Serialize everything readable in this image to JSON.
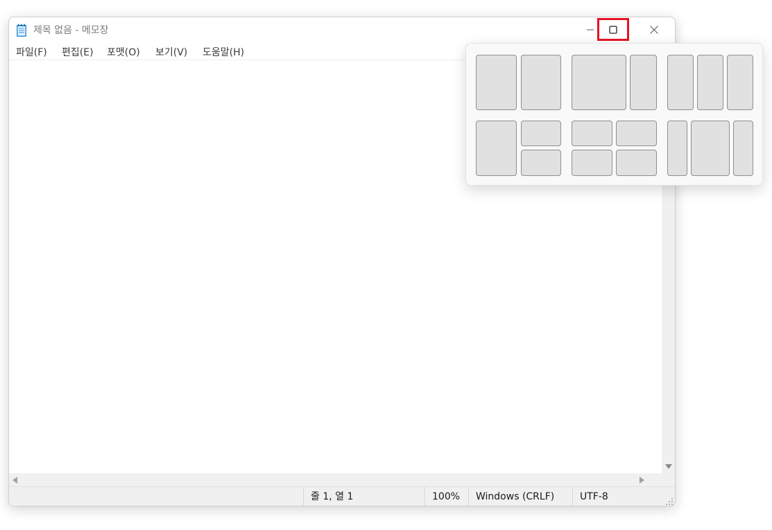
{
  "window": {
    "title": "제목 없음 - 메모장",
    "app_icon": "notepad-icon"
  },
  "title_controls": {
    "minimize_icon": "minimize-icon",
    "maximize_icon": "maximize-icon",
    "close_icon": "close-icon",
    "highlight_color": "#e81123"
  },
  "menubar": {
    "items": [
      {
        "label": "파일(F)"
      },
      {
        "label": "편집(E)"
      },
      {
        "label": "포맷(O)"
      },
      {
        "label": "보기(V)"
      },
      {
        "label": "도움말(H)"
      }
    ]
  },
  "editor": {
    "content": ""
  },
  "statusbar": {
    "position": "줄 1, 열 1",
    "zoom": "100%",
    "line_ending": "Windows (CRLF)",
    "encoding": "UTF-8"
  },
  "snap_layouts": {
    "layouts": [
      {
        "name": "two-equal",
        "zones": 2
      },
      {
        "name": "wide-narrow",
        "zones": 2
      },
      {
        "name": "three-columns",
        "zones": 3
      },
      {
        "name": "half-and-quarters",
        "zones": 3
      },
      {
        "name": "four-quadrants",
        "zones": 4
      },
      {
        "name": "narrow-wide-narrow",
        "zones": 3
      }
    ]
  }
}
